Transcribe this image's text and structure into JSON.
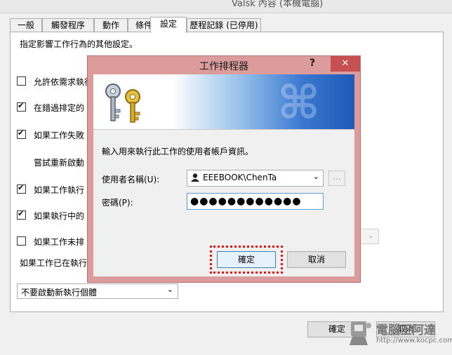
{
  "background_window": {
    "title": "Valsk 內容 (本機電腦)",
    "tabs": [
      "一般",
      "觸發程序",
      "動作",
      "條件",
      "設定",
      "歷程記錄 (已停用)"
    ],
    "active_tab": "設定",
    "description": "指定影響工作行為的其他設定。",
    "options": [
      {
        "label": "允許依需求執行",
        "checked": false
      },
      {
        "label": "在錯過排定的",
        "checked": true
      },
      {
        "label": "如果工作失敗",
        "checked": true
      },
      {
        "label": "嘗試重新啟動",
        "checked": null
      },
      {
        "label": "如果工作執行",
        "checked": true
      },
      {
        "label": "如果執行中的",
        "checked": true
      },
      {
        "label": "如果工作未排",
        "checked": false
      }
    ],
    "running_rule_label": "如果工作已在執行",
    "running_rule_select": "不要啟動新執行個體",
    "ok_label": "確定",
    "cancel_label": "取消"
  },
  "dialog": {
    "title": "工作排程器",
    "help": "?",
    "close": "✕",
    "prompt": "輸入用來執行此工作的使用者帳戶資訊。",
    "username_label": "使用者名稱(U):",
    "username_value": "EEEBOOK\\ChenTa",
    "browse_label": "...",
    "password_label": "密碼(P):",
    "password_mask": "●●●●●●●●●●●●",
    "ok_label": "確定",
    "cancel_label": "取消"
  },
  "watermark": {
    "text": "電腦王阿達",
    "url": "http://www.kocpc.com.tw"
  },
  "colors": {
    "dialog_frame": "#dc9c9c",
    "close_button": "#c75050",
    "highlight": "#e81010",
    "banner_blue": "#1d5ab8"
  }
}
